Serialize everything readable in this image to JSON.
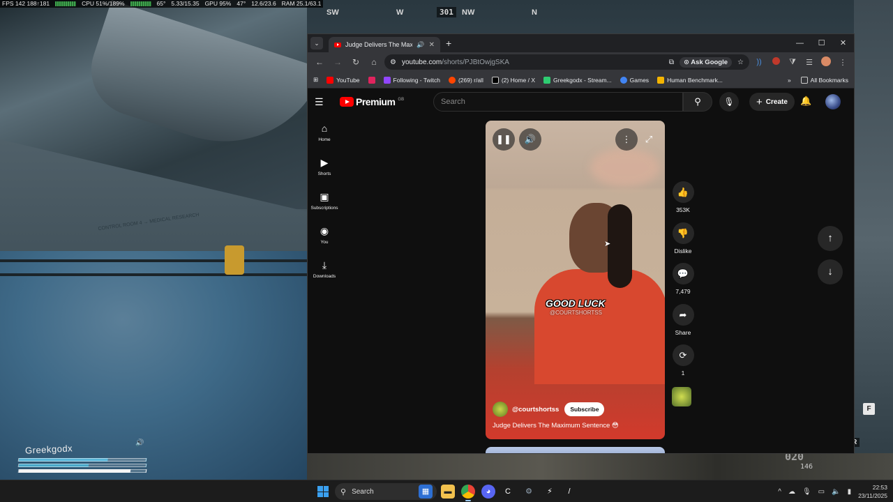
{
  "overlay": {
    "fps_label": "FPS",
    "fps_value": "142",
    "fps_range": "188↑181",
    "cpu": "CPU 51%/189%",
    "gpu_temp": "65°",
    "gpu_mem": "5.33/15.35",
    "gpu": "GPU 95%",
    "cpu_temp": "47°",
    "ram_mem": "12.6/23.6",
    "ram": "RAM 25.1/63.1"
  },
  "game": {
    "compass": {
      "sw": "SW",
      "w": "W",
      "heading": "301",
      "nw": "NW",
      "n": "N"
    },
    "sign": "CONTROL ROOM 4 → MEDICAL RESEARCH",
    "player_name": "Greekgodx",
    "mag": "020",
    "reserve": "146",
    "weapon_label": "CHER",
    "key_hint": "F"
  },
  "browser": {
    "tab_title": "Judge Delivers The Maximum Sentence",
    "url_host": "youtube.com",
    "url_path": "/shorts/PJBtOwjgSKA",
    "ask_google": "Ask Google",
    "bookmarks": [
      {
        "label": "YouTube",
        "color": "#ff0000"
      },
      {
        "label": "",
        "color": "#e0245e"
      },
      {
        "label": "Following - Twitch",
        "color": "#9146ff"
      },
      {
        "label": "(269) r/all",
        "color": "#ff4500"
      },
      {
        "label": "(2) Home / X",
        "color": "#ffffff"
      },
      {
        "label": "Greekgodx - Stream...",
        "color": "#2ecc71"
      },
      {
        "label": "Games",
        "color": "#4285f4"
      },
      {
        "label": "Human Benchmark...",
        "color": "#f4b400"
      }
    ],
    "all_bookmarks": "All Bookmarks"
  },
  "youtube": {
    "logo_word": "Premium",
    "logo_region": "GB",
    "search_placeholder": "Search",
    "create_label": "Create",
    "guide": [
      {
        "label": "Home",
        "icon": "home-icon"
      },
      {
        "label": "Shorts",
        "icon": "shorts-icon"
      },
      {
        "label": "Subscriptions",
        "icon": "subscriptions-icon"
      },
      {
        "label": "You",
        "icon": "you-icon"
      },
      {
        "label": "Downloads",
        "icon": "downloads-icon"
      }
    ],
    "short": {
      "caption": "GOOD LUCK",
      "watermark": "@COURTSHORTSS",
      "channel": "@courtshortss",
      "subscribe": "Subscribe",
      "title": "Judge Delivers The Maximum Sentence 😳"
    },
    "actions": {
      "likes": "353K",
      "dislike": "Dislike",
      "comments": "7,479",
      "share": "Share",
      "remix": "1"
    }
  },
  "taskbar": {
    "search": "Search",
    "time": "22:53",
    "date": "23/11/2025",
    "discord_badge": "99"
  }
}
